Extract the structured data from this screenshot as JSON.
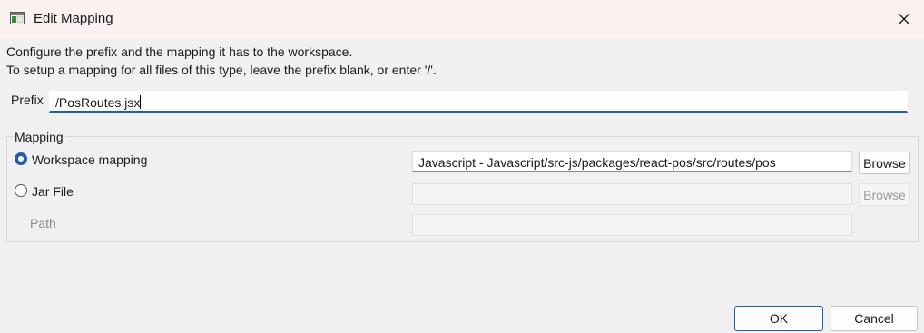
{
  "window": {
    "title": "Edit Mapping"
  },
  "description": {
    "line1": "Configure the prefix and the mapping it has to the workspace.",
    "line2": "To setup a mapping for all files of this type, leave the prefix blank, or enter '/'."
  },
  "prefix": {
    "label": "Prefix",
    "value": "/PosRoutes.jsx"
  },
  "mapping": {
    "group_label": "Mapping",
    "workspace": {
      "label": "Workspace mapping",
      "selected": true,
      "value": "Javascript - Javascript/src-js/packages/react-pos/src/routes/pos",
      "browse_label": "Browse"
    },
    "jar": {
      "label": "Jar File",
      "selected": false,
      "value": "",
      "browse_label": "Browse",
      "path_label": "Path",
      "path_value": ""
    }
  },
  "buttons": {
    "ok": "OK",
    "cancel": "Cancel"
  },
  "icons": {
    "app": "window-icon",
    "close": "close-icon"
  },
  "colors": {
    "accent": "#1f5fa8",
    "titlebar": "#fbf1f1",
    "background": "#f0f0f0"
  }
}
